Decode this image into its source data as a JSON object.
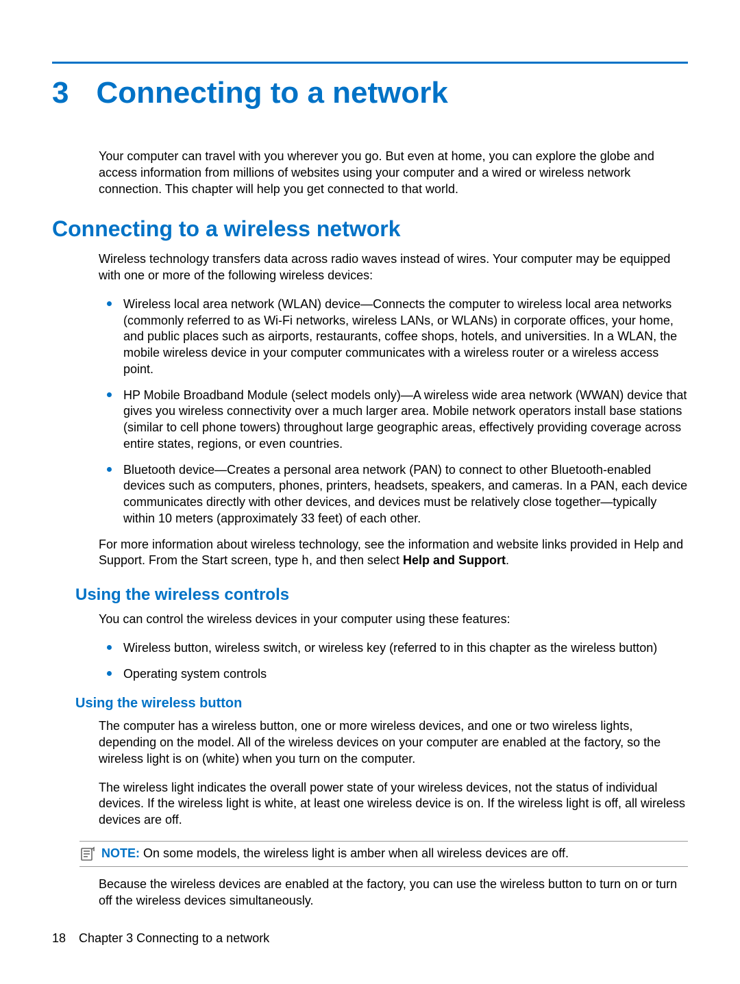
{
  "chapter": {
    "number": "3",
    "title": "Connecting to a network"
  },
  "intro": "Your computer can travel with you wherever you go. But even at home, you can explore the globe and access information from millions of websites using your computer and a wired or wireless network connection. This chapter will help you get connected to that world.",
  "section1": {
    "title": "Connecting to a wireless network",
    "intro": "Wireless technology transfers data across radio waves instead of wires. Your computer may be equipped with one or more of the following wireless devices:",
    "bullets": [
      "Wireless local area network (WLAN) device—Connects the computer to wireless local area networks (commonly referred to as Wi-Fi networks, wireless LANs, or WLANs) in corporate offices, your home, and public places such as airports, restaurants, coffee shops, hotels, and universities. In a WLAN, the mobile wireless device in your computer communicates with a wireless router or a wireless access point.",
      "HP Mobile Broadband Module (select models only)—A wireless wide area network (WWAN) device that gives you wireless connectivity over a much larger area. Mobile network operators install base stations (similar to cell phone towers) throughout large geographic areas, effectively providing coverage across entire states, regions, or even countries.",
      "Bluetooth device—Creates a personal area network (PAN) to connect to other Bluetooth-enabled devices such as computers, phones, printers, headsets, speakers, and cameras. In a PAN, each device communicates directly with other devices, and devices must be relatively close together—typically within 10 meters (approximately 33 feet) of each other."
    ],
    "outro_pre": "For more information about wireless technology, see the information and website links provided in Help and Support. From the Start screen, type ",
    "outro_code": "h",
    "outro_mid": ", and then select ",
    "outro_bold": "Help and Support",
    "outro_post": "."
  },
  "section2": {
    "title": "Using the wireless controls",
    "intro": "You can control the wireless devices in your computer using these features:",
    "bullets": [
      "Wireless button, wireless switch, or wireless key (referred to in this chapter as the wireless button)",
      "Operating system controls"
    ]
  },
  "section3": {
    "title": "Using the wireless button",
    "p1": "The computer has a wireless button, one or more wireless devices, and one or two wireless lights, depending on the model. All of the wireless devices on your computer are enabled at the factory, so the wireless light is on (white) when you turn on the computer.",
    "p2": "The wireless light indicates the overall power state of your wireless devices, not the status of individual devices. If the wireless light is white, at least one wireless device is on. If the wireless light is off, all wireless devices are off.",
    "note_label": "NOTE:",
    "note_text": "On some models, the wireless light is amber when all wireless devices are off.",
    "p3": "Because the wireless devices are enabled at the factory, you can use the wireless button to turn on or turn off the wireless devices simultaneously."
  },
  "footer": {
    "page": "18",
    "chapter_label": "Chapter 3   Connecting to a network"
  }
}
